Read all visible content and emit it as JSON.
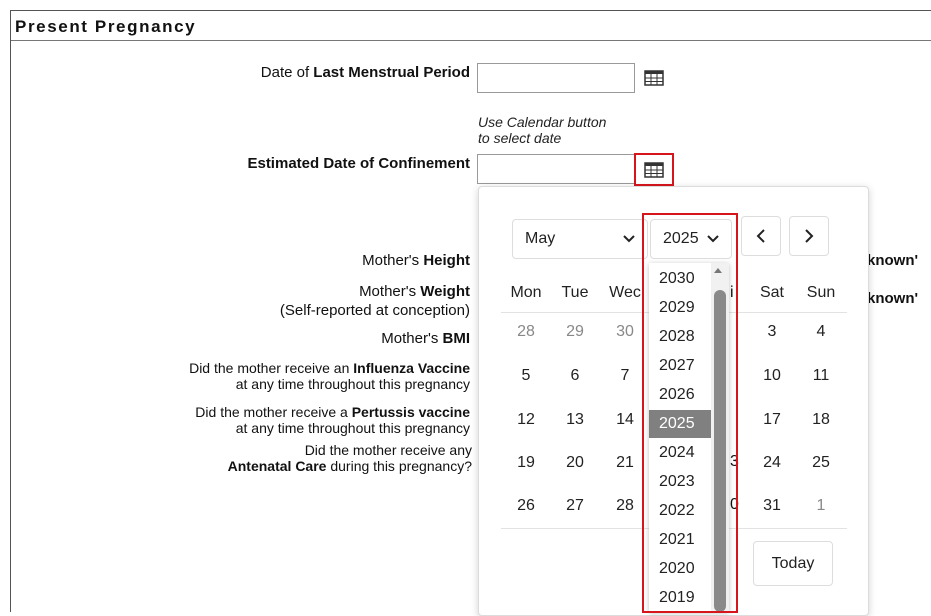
{
  "section": {
    "title": "Present Pregnancy"
  },
  "lmp": {
    "label_prefix": "Date of ",
    "label_bold": "Last Menstrual Period",
    "value": ""
  },
  "hint": {
    "line1": "Use Calendar button",
    "line2": "to select date"
  },
  "edc": {
    "label": "Estimated Date of Confinement",
    "value": ""
  },
  "height": {
    "prefix": "Mother's ",
    "bold": "Height"
  },
  "weight": {
    "prefix": "Mother's ",
    "bold": "Weight",
    "note": "(Self-reported at conception)"
  },
  "bmi": {
    "prefix": "Mother's ",
    "bold": "BMI"
  },
  "influenza": {
    "line1_prefix": "Did the mother receive an ",
    "line1_bold": "Influenza Vaccine",
    "line2": "at any time throughout this pregnancy"
  },
  "pertussis": {
    "line1_prefix": "Did the mother receive a ",
    "line1_bold": "Pertussis vaccine",
    "line2": "at any time throughout this pregnancy"
  },
  "antenatal": {
    "line1": "Did the mother receive any",
    "line2_bold": "Antenatal Care",
    "line2_suffix": " during this pregnancy?"
  },
  "cutoff": {
    "height_right": "known'",
    "weight_right": "known'",
    "pertussis_peek": "i",
    "row3_peek": "3",
    "row4_peek": "0"
  },
  "calendar": {
    "month": "May",
    "year": "2025",
    "weekdays": [
      "Mon",
      "Tue",
      "Wed",
      "Thu",
      "Fri",
      "Sat",
      "Sun"
    ],
    "weekday_visible": [
      "Mon",
      "Tue",
      "Wec",
      "",
      "i",
      "Sat",
      "Sun"
    ],
    "weeks": [
      [
        {
          "d": "28",
          "m": true
        },
        {
          "d": "29",
          "m": true
        },
        {
          "d": "30",
          "m": true
        },
        {
          "d": ""
        },
        {
          "d": ""
        },
        {
          "d": "3"
        },
        {
          "d": "4"
        }
      ],
      [
        {
          "d": "5"
        },
        {
          "d": "6"
        },
        {
          "d": "7"
        },
        {
          "d": ""
        },
        {
          "d": ""
        },
        {
          "d": "10"
        },
        {
          "d": "11"
        }
      ],
      [
        {
          "d": "12"
        },
        {
          "d": "13"
        },
        {
          "d": "14"
        },
        {
          "d": ""
        },
        {
          "d": ""
        },
        {
          "d": "17"
        },
        {
          "d": "18"
        }
      ],
      [
        {
          "d": "19"
        },
        {
          "d": "20"
        },
        {
          "d": "21"
        },
        {
          "d": ""
        },
        {
          "d": ""
        },
        {
          "d": "24"
        },
        {
          "d": "25"
        }
      ],
      [
        {
          "d": "26"
        },
        {
          "d": "27"
        },
        {
          "d": "28"
        },
        {
          "d": ""
        },
        {
          "d": ""
        },
        {
          "d": "31"
        },
        {
          "d": "1",
          "m": true
        }
      ]
    ],
    "today_label": "Today",
    "years": [
      "2030",
      "2029",
      "2028",
      "2027",
      "2026",
      "2025",
      "2024",
      "2023",
      "2022",
      "2021",
      "2020",
      "2019"
    ],
    "selected_year": "2025"
  },
  "colors": {
    "highlight": "#d6161c",
    "selected_year_bg": "#808080"
  }
}
